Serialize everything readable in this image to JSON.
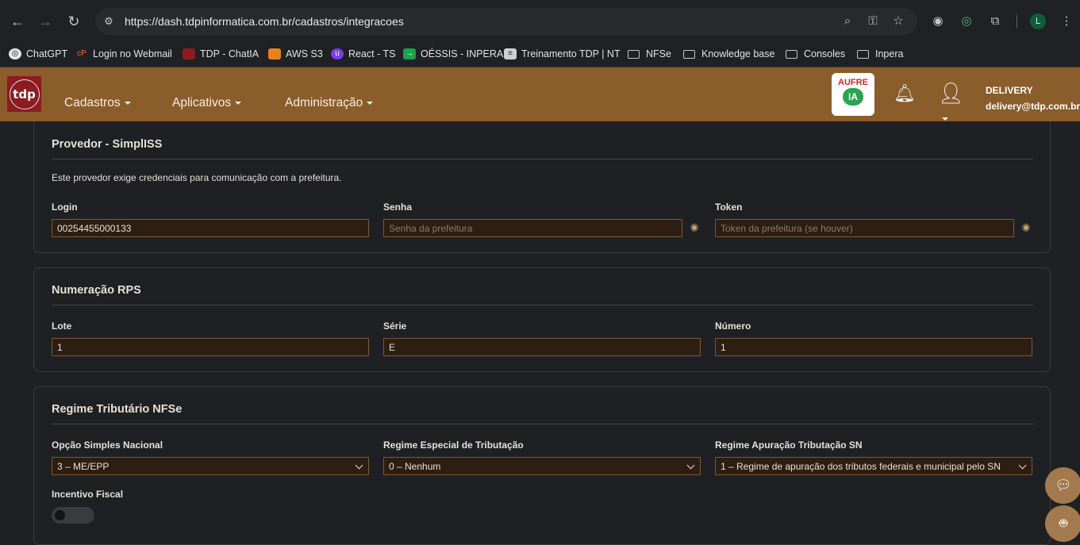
{
  "browser": {
    "url": "https://dash.tdpinformatica.com.br/cadastros/integracoes",
    "profile_initial": "L",
    "bookmarks": [
      {
        "label": "ChatGPT"
      },
      {
        "label": "Login no Webmail"
      },
      {
        "label": "TDP - ChatIA"
      },
      {
        "label": "AWS S3"
      },
      {
        "label": "React - TS"
      },
      {
        "label": "OÉSSIS - INPERA"
      },
      {
        "label": "Treinamento TDP | NT"
      },
      {
        "label": "NFSe"
      },
      {
        "label": "Knowledge base"
      },
      {
        "label": "Consoles"
      },
      {
        "label": "Inpera"
      }
    ]
  },
  "header": {
    "logo_text": "tdp",
    "menu": [
      "Cadastros",
      "Aplicativos",
      "Administração"
    ],
    "aufre_label": "AUFRE",
    "aufre_badge": "IA",
    "user_name": "DELIVERY",
    "user_email": "delivery@tdp.com.br"
  },
  "provider": {
    "title": "Provedor - SimplISS",
    "description": "Este provedor exige credenciais para comunicação com a prefeitura.",
    "login_label": "Login",
    "login_value": "00254455000133",
    "password_label": "Senha",
    "password_placeholder": "Senha da prefeitura",
    "token_label": "Token",
    "token_placeholder": "Token da prefeitura (se houver)"
  },
  "rps": {
    "title": "Numeração RPS",
    "lote_label": "Lote",
    "lote_value": "1",
    "serie_label": "Série",
    "serie_value": "E",
    "numero_label": "Número",
    "numero_value": "1"
  },
  "regime": {
    "title": "Regime Tributário NFSe",
    "simples_label": "Opção Simples Nacional",
    "simples_value": "3 – ME/EPP",
    "especial_label": "Regime Especial de Tributação",
    "especial_value": "0 – Nenhum",
    "apuracao_label": "Regime Apuração Tributação SN",
    "apuracao_value": "1 – Regime de apuração dos tributos federais e municipal pelo SN",
    "incentivo_label": "Incentivo Fiscal",
    "incentivo_on": false
  }
}
